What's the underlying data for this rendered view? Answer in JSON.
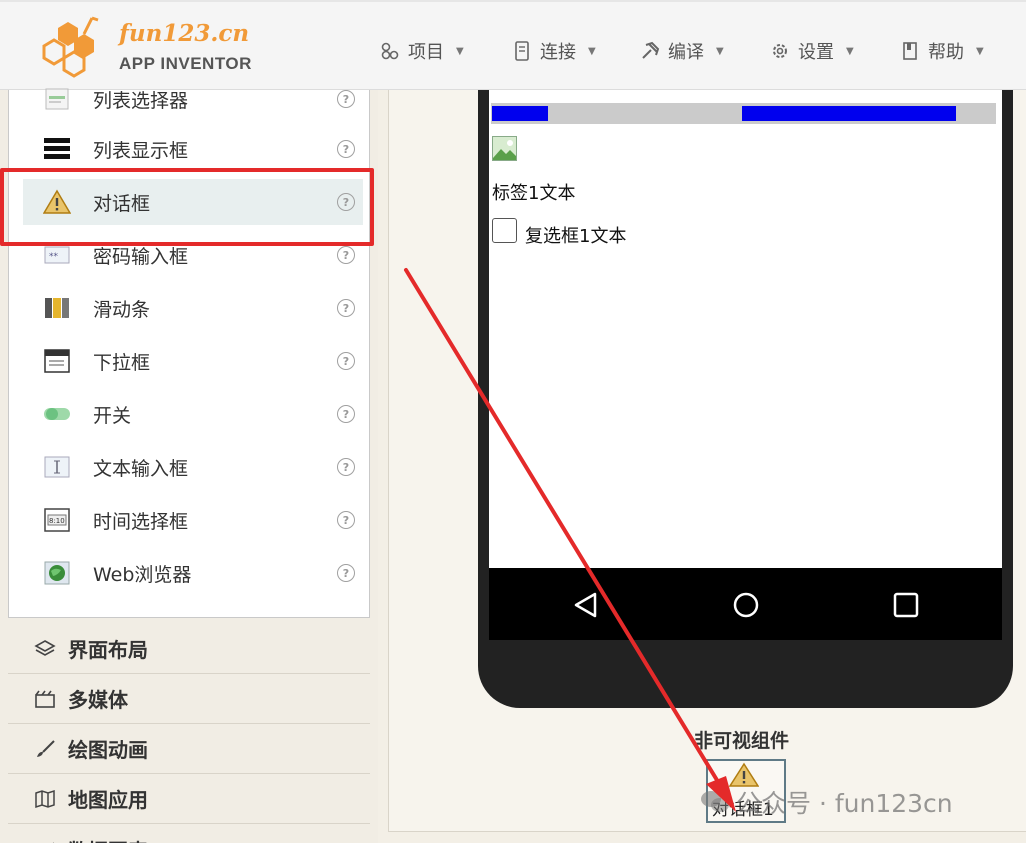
{
  "header": {
    "brand_name": "fun123.cn",
    "brand_sub": "APP INVENTOR",
    "menus": [
      {
        "label": "项目",
        "icon": "project-icon"
      },
      {
        "label": "连接",
        "icon": "connect-icon"
      },
      {
        "label": "编译",
        "icon": "build-icon"
      },
      {
        "label": "设置",
        "icon": "settings-icon"
      },
      {
        "label": "帮助",
        "icon": "help-icon"
      }
    ]
  },
  "palette": {
    "items": [
      {
        "label": "列表选择器",
        "icon": "listpicker-icon"
      },
      {
        "label": "列表显示框",
        "icon": "listview-icon"
      },
      {
        "label": "对话框",
        "icon": "notifier-warning-icon",
        "selected": true
      },
      {
        "label": "密码输入框",
        "icon": "password-icon"
      },
      {
        "label": "滑动条",
        "icon": "slider-icon"
      },
      {
        "label": "下拉框",
        "icon": "spinner-icon"
      },
      {
        "label": "开关",
        "icon": "switch-icon"
      },
      {
        "label": "文本输入框",
        "icon": "textbox-icon"
      },
      {
        "label": "时间选择框",
        "icon": "timepicker-icon"
      },
      {
        "label": "Web浏览器",
        "icon": "webviewer-icon"
      }
    ],
    "help_glyph": "?",
    "categories": [
      {
        "label": "界面布局",
        "icon": "layout-icon"
      },
      {
        "label": "多媒体",
        "icon": "media-icon"
      },
      {
        "label": "绘图动画",
        "icon": "drawing-icon"
      },
      {
        "label": "地图应用",
        "icon": "map-icon"
      },
      {
        "label": "数据图表",
        "icon": "chart-icon"
      }
    ]
  },
  "viewer": {
    "label_text": "标签1文本",
    "checkbox_text": "复选框1文本",
    "nonvisible_title": "非可视组件",
    "nonvisible_component": "对话框1"
  },
  "watermark": "公众号 · fun123cn",
  "colors": {
    "brand_orange": "#f19a38",
    "highlight_red": "#e42a2a",
    "progress_blue": "#0000ee"
  }
}
